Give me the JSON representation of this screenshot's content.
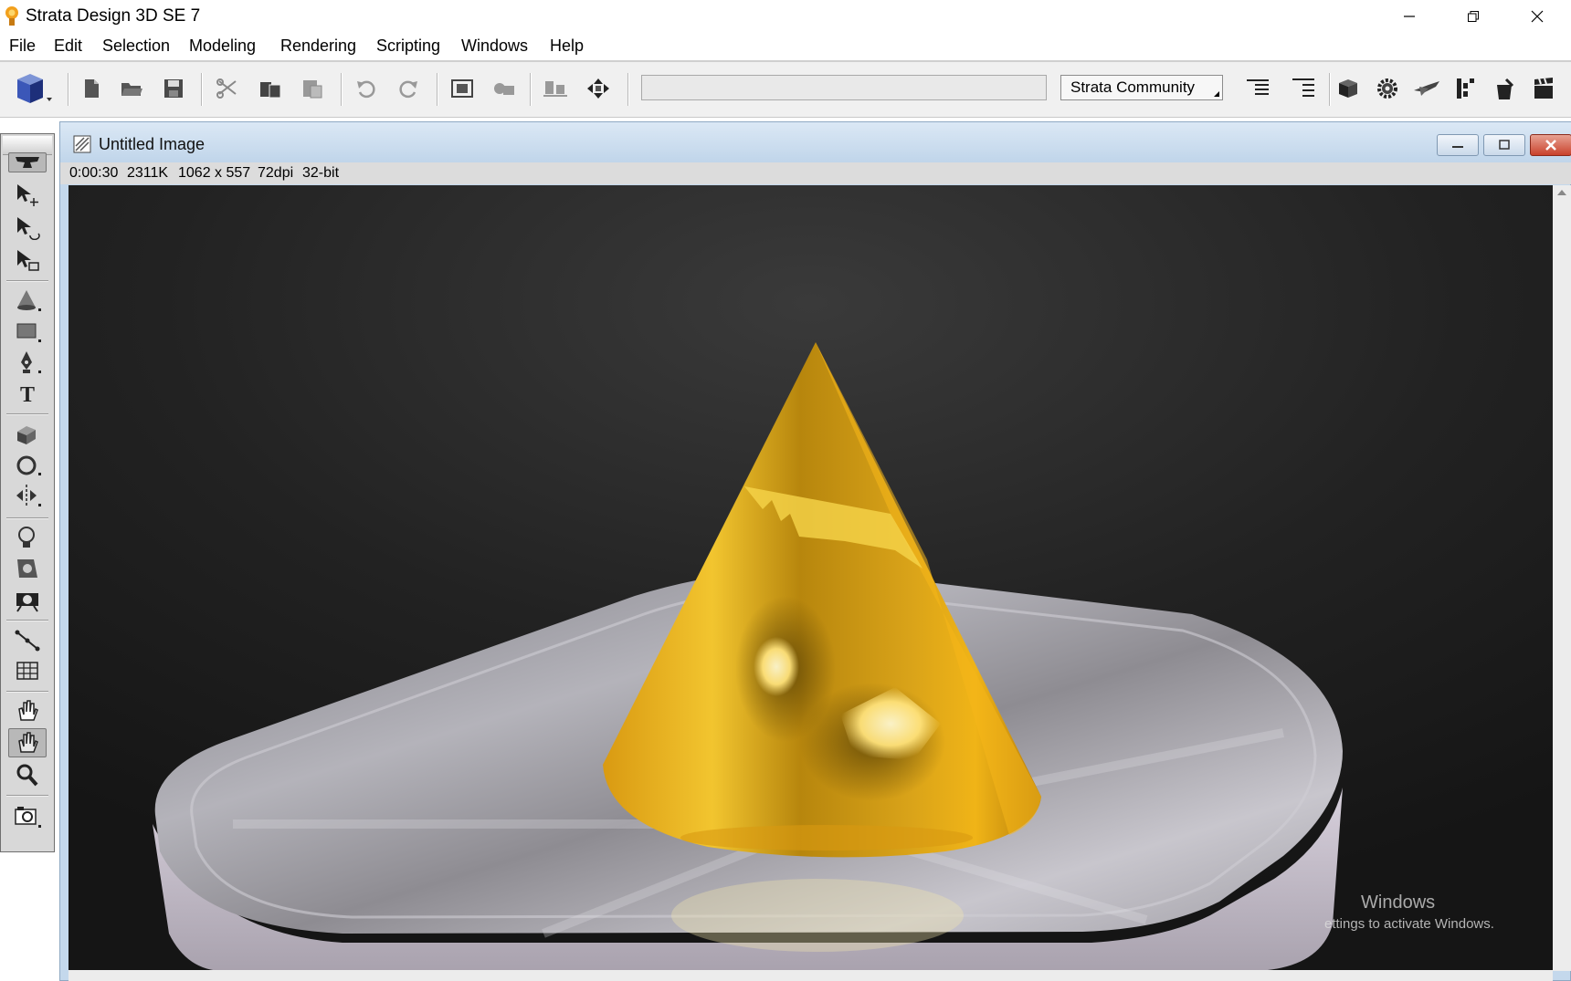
{
  "app": {
    "title": "Strata Design 3D SE 7"
  },
  "window_controls": {
    "minimize": "minimize-icon",
    "restore": "restore-icon",
    "close": "close-icon"
  },
  "menu": [
    "File",
    "Edit",
    "Selection",
    "Modeling",
    "Rendering",
    "Scripting",
    "Windows",
    "Help"
  ],
  "toolbar": {
    "icons": [
      "strata-cube-icon",
      "new-document-icon",
      "open-folder-icon",
      "save-icon",
      "cut-icon",
      "copy-icon",
      "paste-icon",
      "undo-icon",
      "redo-icon",
      "group-icon",
      "ungroup-icon",
      "align-icon",
      "center-icon",
      "text-lines-icon",
      "text-lines-right-icon",
      "cube-icon",
      "gear-icon",
      "airplane-icon",
      "steps-icon",
      "bucket-icon",
      "clapper-icon"
    ],
    "dropdown_label": "Strata Community"
  },
  "tools": [
    "object-move-icon",
    "object-rotate-icon",
    "object-scale-icon",
    "cone-icon",
    "rectangle-icon",
    "pen-icon",
    "text-icon",
    "extrude-icon",
    "lathe-icon",
    "mirror-icon",
    "light-bulb-icon",
    "spotlight-icon",
    "camera-icon",
    "path-icon",
    "grid-icon",
    "hand-icon",
    "glove-icon",
    "magnify-icon",
    "camera-capture-icon"
  ],
  "document": {
    "title": "Untitled Image",
    "status": {
      "time": "0:00:30",
      "size": "2311K",
      "dimensions": "1062 x 557",
      "dpi": "72dpi",
      "depth": "32-bit"
    }
  },
  "watermark": {
    "line1": "Windows",
    "line2": "ettings to activate Windows."
  },
  "colors": {
    "render_bg": "#1f1f1f",
    "cone_gold": "#e2a21a",
    "plate_silver": "#a9a7ac",
    "doc_frame": "#c4d8ec"
  }
}
